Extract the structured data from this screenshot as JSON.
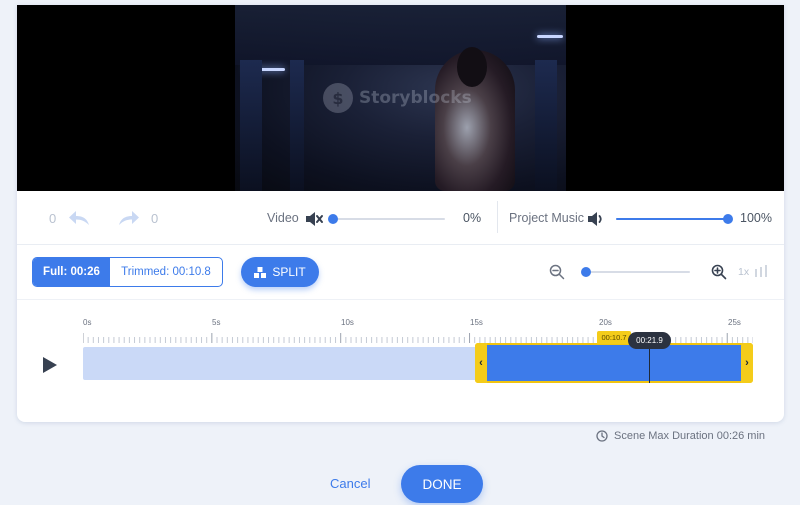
{
  "video": {
    "watermark": "Storyblocks"
  },
  "history": {
    "undo_count": "0",
    "redo_count": "0"
  },
  "audio": {
    "video_label": "Video",
    "video_percent": "0%",
    "video_level": 0,
    "video_muted": true,
    "music_label": "Project Music",
    "music_percent": "100%",
    "music_level": 1
  },
  "toolbar": {
    "full_label": "Full: 00:26",
    "trimmed_label": "Trimmed: 00:10.8",
    "split_label": "SPLIT",
    "zoom_level": 0,
    "speed_label": "1x"
  },
  "timeline": {
    "ticks": [
      "0s",
      "5s",
      "10s",
      "15s",
      "20s",
      "25s"
    ],
    "trim_start_label": "00:10.7",
    "playhead_label": "00:21.9"
  },
  "footer": {
    "scene_max": "Scene Max Duration 00:26 min",
    "cancel_label": "Cancel",
    "done_label": "DONE"
  },
  "colors": {
    "accent": "#3d7bea",
    "trim_handle": "#f4cc1a",
    "clip_background": "#cad9f7"
  },
  "icons": {
    "undo": "undo-icon",
    "redo": "redo-icon",
    "video_volume": "speaker-muted-icon",
    "music_volume": "speaker-icon",
    "split": "split-icon",
    "zoom_out": "zoom-out-icon",
    "zoom_in": "zoom-in-icon",
    "play": "play-icon",
    "clock": "clock-icon"
  }
}
